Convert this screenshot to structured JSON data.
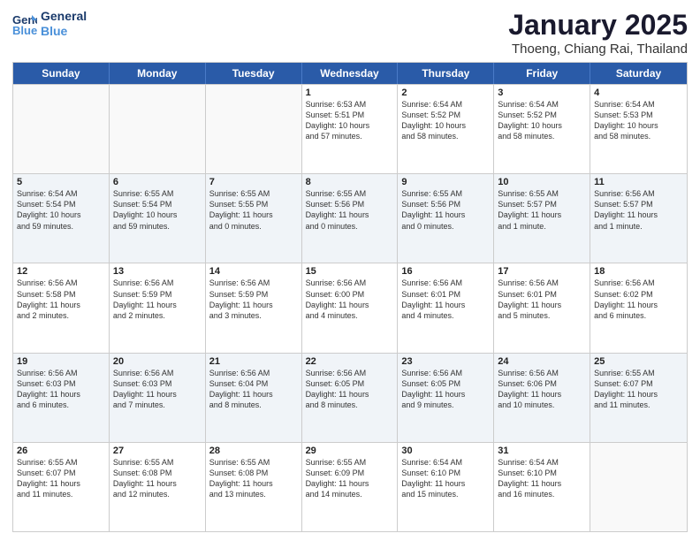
{
  "logo": {
    "line1": "General",
    "line2": "Blue"
  },
  "title": "January 2025",
  "subtitle": "Thoeng, Chiang Rai, Thailand",
  "weekdays": [
    "Sunday",
    "Monday",
    "Tuesday",
    "Wednesday",
    "Thursday",
    "Friday",
    "Saturday"
  ],
  "weeks": [
    [
      {
        "day": "",
        "info": ""
      },
      {
        "day": "",
        "info": ""
      },
      {
        "day": "",
        "info": ""
      },
      {
        "day": "1",
        "info": "Sunrise: 6:53 AM\nSunset: 5:51 PM\nDaylight: 10 hours\nand 57 minutes."
      },
      {
        "day": "2",
        "info": "Sunrise: 6:54 AM\nSunset: 5:52 PM\nDaylight: 10 hours\nand 58 minutes."
      },
      {
        "day": "3",
        "info": "Sunrise: 6:54 AM\nSunset: 5:52 PM\nDaylight: 10 hours\nand 58 minutes."
      },
      {
        "day": "4",
        "info": "Sunrise: 6:54 AM\nSunset: 5:53 PM\nDaylight: 10 hours\nand 58 minutes."
      }
    ],
    [
      {
        "day": "5",
        "info": "Sunrise: 6:54 AM\nSunset: 5:54 PM\nDaylight: 10 hours\nand 59 minutes."
      },
      {
        "day": "6",
        "info": "Sunrise: 6:55 AM\nSunset: 5:54 PM\nDaylight: 10 hours\nand 59 minutes."
      },
      {
        "day": "7",
        "info": "Sunrise: 6:55 AM\nSunset: 5:55 PM\nDaylight: 11 hours\nand 0 minutes."
      },
      {
        "day": "8",
        "info": "Sunrise: 6:55 AM\nSunset: 5:56 PM\nDaylight: 11 hours\nand 0 minutes."
      },
      {
        "day": "9",
        "info": "Sunrise: 6:55 AM\nSunset: 5:56 PM\nDaylight: 11 hours\nand 0 minutes."
      },
      {
        "day": "10",
        "info": "Sunrise: 6:55 AM\nSunset: 5:57 PM\nDaylight: 11 hours\nand 1 minute."
      },
      {
        "day": "11",
        "info": "Sunrise: 6:56 AM\nSunset: 5:57 PM\nDaylight: 11 hours\nand 1 minute."
      }
    ],
    [
      {
        "day": "12",
        "info": "Sunrise: 6:56 AM\nSunset: 5:58 PM\nDaylight: 11 hours\nand 2 minutes."
      },
      {
        "day": "13",
        "info": "Sunrise: 6:56 AM\nSunset: 5:59 PM\nDaylight: 11 hours\nand 2 minutes."
      },
      {
        "day": "14",
        "info": "Sunrise: 6:56 AM\nSunset: 5:59 PM\nDaylight: 11 hours\nand 3 minutes."
      },
      {
        "day": "15",
        "info": "Sunrise: 6:56 AM\nSunset: 6:00 PM\nDaylight: 11 hours\nand 4 minutes."
      },
      {
        "day": "16",
        "info": "Sunrise: 6:56 AM\nSunset: 6:01 PM\nDaylight: 11 hours\nand 4 minutes."
      },
      {
        "day": "17",
        "info": "Sunrise: 6:56 AM\nSunset: 6:01 PM\nDaylight: 11 hours\nand 5 minutes."
      },
      {
        "day": "18",
        "info": "Sunrise: 6:56 AM\nSunset: 6:02 PM\nDaylight: 11 hours\nand 6 minutes."
      }
    ],
    [
      {
        "day": "19",
        "info": "Sunrise: 6:56 AM\nSunset: 6:03 PM\nDaylight: 11 hours\nand 6 minutes."
      },
      {
        "day": "20",
        "info": "Sunrise: 6:56 AM\nSunset: 6:03 PM\nDaylight: 11 hours\nand 7 minutes."
      },
      {
        "day": "21",
        "info": "Sunrise: 6:56 AM\nSunset: 6:04 PM\nDaylight: 11 hours\nand 8 minutes."
      },
      {
        "day": "22",
        "info": "Sunrise: 6:56 AM\nSunset: 6:05 PM\nDaylight: 11 hours\nand 8 minutes."
      },
      {
        "day": "23",
        "info": "Sunrise: 6:56 AM\nSunset: 6:05 PM\nDaylight: 11 hours\nand 9 minutes."
      },
      {
        "day": "24",
        "info": "Sunrise: 6:56 AM\nSunset: 6:06 PM\nDaylight: 11 hours\nand 10 minutes."
      },
      {
        "day": "25",
        "info": "Sunrise: 6:55 AM\nSunset: 6:07 PM\nDaylight: 11 hours\nand 11 minutes."
      }
    ],
    [
      {
        "day": "26",
        "info": "Sunrise: 6:55 AM\nSunset: 6:07 PM\nDaylight: 11 hours\nand 11 minutes."
      },
      {
        "day": "27",
        "info": "Sunrise: 6:55 AM\nSunset: 6:08 PM\nDaylight: 11 hours\nand 12 minutes."
      },
      {
        "day": "28",
        "info": "Sunrise: 6:55 AM\nSunset: 6:08 PM\nDaylight: 11 hours\nand 13 minutes."
      },
      {
        "day": "29",
        "info": "Sunrise: 6:55 AM\nSunset: 6:09 PM\nDaylight: 11 hours\nand 14 minutes."
      },
      {
        "day": "30",
        "info": "Sunrise: 6:54 AM\nSunset: 6:10 PM\nDaylight: 11 hours\nand 15 minutes."
      },
      {
        "day": "31",
        "info": "Sunrise: 6:54 AM\nSunset: 6:10 PM\nDaylight: 11 hours\nand 16 minutes."
      },
      {
        "day": "",
        "info": ""
      }
    ]
  ]
}
